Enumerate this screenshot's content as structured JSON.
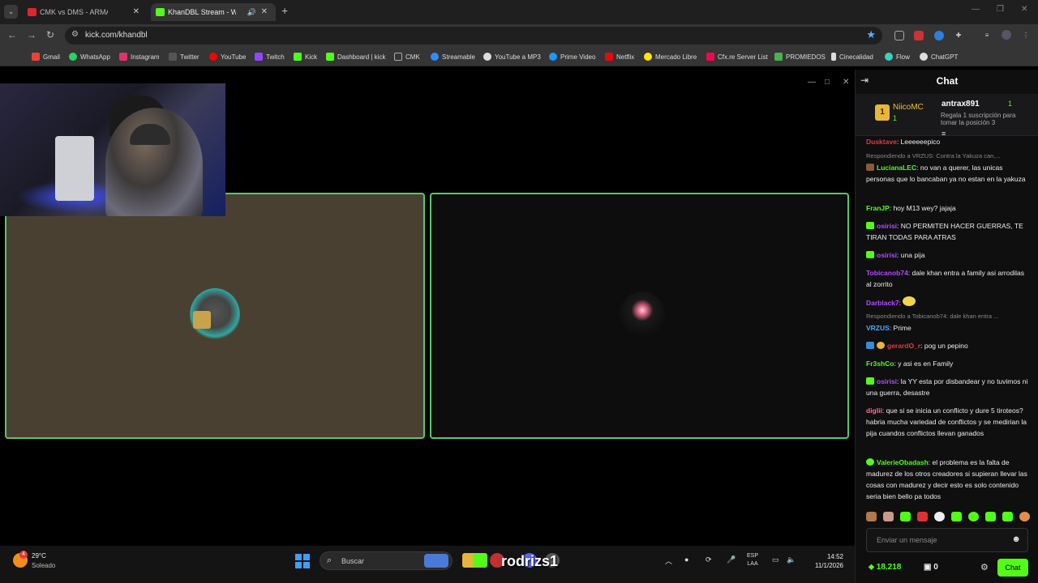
{
  "browser": {
    "tabs": [
      {
        "label": "CMK vs DMS - ARMAS LARGAS",
        "favicon_color": "#e0262c"
      },
      {
        "label": "KhanDBL Stream - Watch Li",
        "favicon_color": "#53fc18"
      }
    ],
    "url": "kick.com/khandbl",
    "bookmarks": [
      {
        "label": "Gmail",
        "color": "#ea4335"
      },
      {
        "label": "WhatsApp",
        "color": "#25d366"
      },
      {
        "label": "Instagram",
        "color": "#e1306c"
      },
      {
        "label": "Twitter",
        "color": "#dddddd"
      },
      {
        "label": "YouTube",
        "color": "#ff0000"
      },
      {
        "label": "Twitch",
        "color": "#9146ff"
      },
      {
        "label": "Kick",
        "color": "#53fc18"
      },
      {
        "label": "Dashboard | kick",
        "color": "#53fc18"
      },
      {
        "label": "CMK",
        "color": "#aaaaaa"
      },
      {
        "label": "Streamable",
        "color": "#2f8cff"
      },
      {
        "label": "YouTube a MP3",
        "color": "#dddddd"
      },
      {
        "label": "Prime Video",
        "color": "#1a98ff"
      },
      {
        "label": "Netflix",
        "color": "#e50914"
      },
      {
        "label": "Mercado Libre",
        "color": "#ffe600"
      },
      {
        "label": "Cfx.re Server List",
        "color": "#f40552"
      },
      {
        "label": "PROMIEDOS",
        "color": "#4caf50"
      },
      {
        "label": "Cinecalidad",
        "color": "#dddddd"
      },
      {
        "label": "Flow",
        "color": "#3ad1c1"
      },
      {
        "label": "ChatGPT",
        "color": "#dddddd"
      }
    ]
  },
  "chat": {
    "title": "Chat",
    "leaderboard": {
      "rank": "1",
      "first_name": "NiicoMC",
      "first_count": "1",
      "second_name": "antrax891",
      "second_count": "1",
      "gift_text": "Regala 1 suscripción para tomar la posición 3"
    },
    "messages": [
      {
        "user": "Dusktave",
        "color": "#e23b3b",
        "text": "Leeeeeepico",
        "reply": ""
      },
      {
        "user": "LucianaLEC",
        "color": "#53fc18",
        "text": "no van a querer, las unicas personas que lo bancaban ya no estan en la yakuza",
        "reply": "Respondiendo a VRZUS: Contra la Yakuza can,..."
      },
      {
        "user": "FranJP",
        "color": "#53fc18",
        "text": "hoy M13 wey? jajaja",
        "reply": ""
      },
      {
        "user": "osirisi",
        "color": "#b14cff",
        "text": "NO PERMITEN HACER GUERRAS, TE TIRAN TODAS PARA ATRAS",
        "reply": ""
      },
      {
        "user": "osirisi",
        "color": "#b14cff",
        "text": "una pija",
        "reply": ""
      },
      {
        "user": "Tobicanob74",
        "color": "#b14cff",
        "text": "dale khan entra a family asi arrodilas al zorrito",
        "reply": ""
      },
      {
        "user": "Darblack7",
        "color": "#b14cff",
        "text": "",
        "reply": ""
      },
      {
        "user": "VRZUS",
        "color": "#4aa8ff",
        "text": "Prime",
        "reply": "Respondiendo a Tobicanob74: dale khan entra ..."
      },
      {
        "user": "gerardO_r",
        "color": "#e23b3b",
        "text": "pog un pepino",
        "reply": ""
      },
      {
        "user": "Fr3shCo",
        "color": "#53fc18",
        "text": "y asi es en Family",
        "reply": ""
      },
      {
        "user": "osirisi",
        "color": "#b14cff",
        "text": "la YY esta por disbandear y no tuvimos ni una guerra, desastre",
        "reply": ""
      },
      {
        "user": "diglii",
        "color": "#ff6b9d",
        "text": "que si se inicia un conflicto y dure 5 tiroteos? habria mucha variedad de conflictos y se medirian la pija cuandos conflictos llevan ganados",
        "reply": ""
      },
      {
        "user": "ValerieObadash",
        "color": "#53fc18",
        "text": "el problema es la falta de madurez de los otros creadores si supieran llevar las cosas con madurez y decir esto es solo contenido seria bien bello pa todos",
        "reply": ""
      }
    ],
    "input_placeholder": "Enviar un mensaje",
    "points": "18.218",
    "gifts": "0",
    "send_label": "Chat"
  },
  "overlay": {
    "streamer_name": "rodrizs1"
  },
  "taskbar": {
    "temperature": "29°C",
    "condition": "Soleado",
    "weather_badge": "4",
    "search_placeholder": "Buscar",
    "lang_1": "ESP",
    "lang_2": "LAA",
    "time": "14:52",
    "date": "11/1/2026"
  }
}
